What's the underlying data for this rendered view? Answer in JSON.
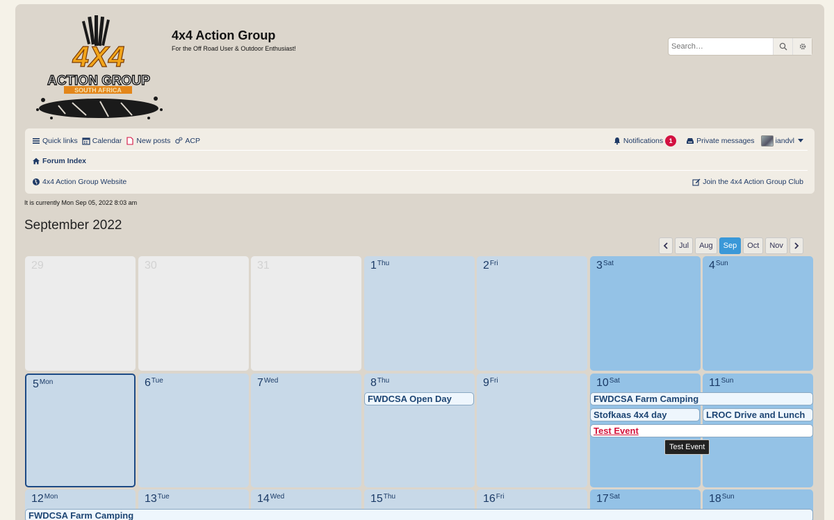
{
  "header": {
    "logo_text": "4x4 ACTION GROUP SOUTH AFRICA",
    "site_title": "4x4 Action Group",
    "site_desc": "For the Off Road User & Outdoor Enthusiast!",
    "search_placeholder": "Search…"
  },
  "nav": {
    "quick_links": "Quick links",
    "calendar": "Calendar",
    "new_posts": "New posts",
    "acp": "ACP",
    "notifications": "Notifications",
    "notifications_count": "1",
    "private_messages": "Private messages",
    "username": "iandvl",
    "forum_index": "Forum Index",
    "website": "4x4 Action Group Website",
    "join_club": "Join the 4x4 Action Group Club"
  },
  "current_time": "It is currently Mon Sep 05, 2022 8:03 am",
  "month_title": "September 2022",
  "month_nav": [
    "Jul",
    "Aug",
    "Sep",
    "Oct",
    "Nov"
  ],
  "month_nav_active": "Sep",
  "days": [
    {
      "num": "29",
      "name": "",
      "kind": "other"
    },
    {
      "num": "30",
      "name": "",
      "kind": "other"
    },
    {
      "num": "31",
      "name": "",
      "kind": "other"
    },
    {
      "num": "1",
      "name": "Thu",
      "kind": "wk"
    },
    {
      "num": "2",
      "name": "Fri",
      "kind": "wk"
    },
    {
      "num": "3",
      "name": "Sat",
      "kind": "we"
    },
    {
      "num": "4",
      "name": "Sun",
      "kind": "we"
    },
    {
      "num": "5",
      "name": "Mon",
      "kind": "today"
    },
    {
      "num": "6",
      "name": "Tue",
      "kind": "wk"
    },
    {
      "num": "7",
      "name": "Wed",
      "kind": "wk"
    },
    {
      "num": "8",
      "name": "Thu",
      "kind": "wk"
    },
    {
      "num": "9",
      "name": "Fri",
      "kind": "wk"
    },
    {
      "num": "10",
      "name": "Sat",
      "kind": "we"
    },
    {
      "num": "11",
      "name": "Sun",
      "kind": "we"
    },
    {
      "num": "12",
      "name": "Mon",
      "kind": "wk"
    },
    {
      "num": "13",
      "name": "Tue",
      "kind": "wk"
    },
    {
      "num": "14",
      "name": "Wed",
      "kind": "wk"
    },
    {
      "num": "15",
      "name": "Thu",
      "kind": "wk"
    },
    {
      "num": "16",
      "name": "Fri",
      "kind": "wk"
    },
    {
      "num": "17",
      "name": "Sat",
      "kind": "we"
    },
    {
      "num": "18",
      "name": "Sun",
      "kind": "we"
    }
  ],
  "events": {
    "open_day": "FWDCSA Open Day",
    "farm_camping": "FWDCSA Farm Camping",
    "stofkaas": "Stofkaas 4x4 day",
    "lroc": "LROC Drive and Lunch",
    "test_event": "Test Event",
    "farm_camping_2": "FWDCSA Farm Camping"
  },
  "tooltip": "Test Event"
}
